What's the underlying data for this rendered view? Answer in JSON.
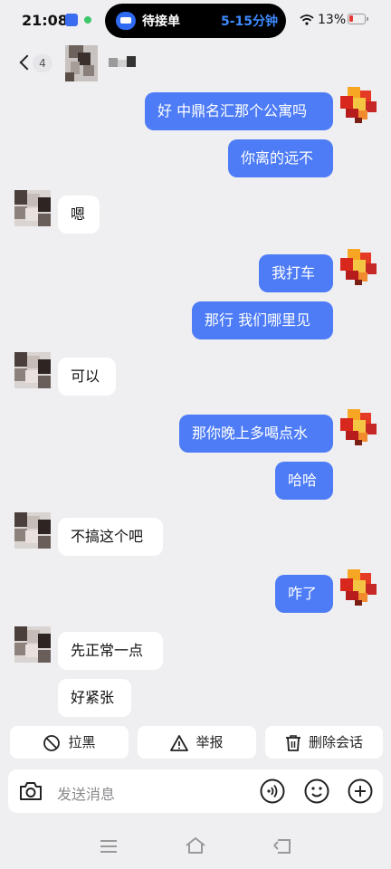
{
  "status_bar": {
    "time": "21:08",
    "battery_text": "13%"
  },
  "island": {
    "label": "待接单",
    "eta": "5-15分钟"
  },
  "header": {
    "unread_count": "4"
  },
  "messages": [
    {
      "side": "out",
      "text": "好 中鼎名汇那个公寓吗"
    },
    {
      "side": "out",
      "text": "你离的远不"
    },
    {
      "side": "in",
      "text": "嗯"
    },
    {
      "side": "out",
      "text": "我打车"
    },
    {
      "side": "out",
      "text": "那行 我们哪里见"
    },
    {
      "side": "in",
      "text": "可以"
    },
    {
      "side": "out",
      "text": "那你晚上多喝点水"
    },
    {
      "side": "out",
      "text": "哈哈"
    },
    {
      "side": "in",
      "text": "不搞这个吧"
    },
    {
      "side": "out",
      "text": "咋了"
    },
    {
      "side": "in",
      "text": "先正常一点"
    },
    {
      "side": "in",
      "text": "好紧张"
    }
  ],
  "actions": {
    "block": "拉黑",
    "report": "举报",
    "delete": "删除会话"
  },
  "input": {
    "placeholder": "发送消息"
  },
  "colors": {
    "outgoing_bubble": "#4d7cf6",
    "background": "#efeff2",
    "accent": "#2f6bf2"
  }
}
